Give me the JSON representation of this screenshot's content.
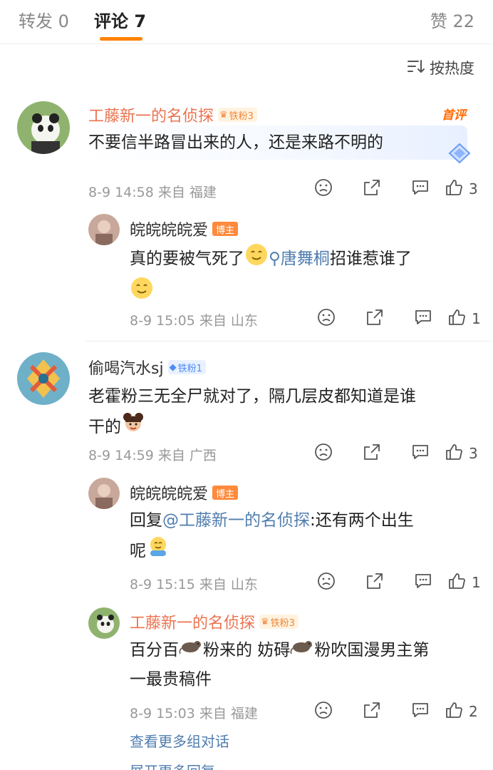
{
  "tabs": [
    {
      "label": "转发 0"
    },
    {
      "label": "评论 7"
    },
    {
      "label": "赞 22"
    }
  ],
  "sort": {
    "label": "按热度"
  },
  "comments": [
    {
      "user": "工藤新一的名侦探",
      "badge": "铁粉3",
      "top_label": "首评",
      "text": "不要信半路冒出来的人，还是来路不明的",
      "time": "8-9 14:58 来自 福建",
      "likes": "3"
    },
    {
      "user": "皖皖皖皖爱",
      "badge": "博主",
      "text_a": "真的要被气死了",
      "topic": "唐舞桐",
      "text_b": "招谁惹谁了",
      "time": "8-9 15:05 来自 山东",
      "likes": "1"
    },
    {
      "user": "偷喝汽水sj",
      "badge": "铁粉1",
      "text_a": "老霍粉三无全尸就对了，隔几层皮都知道是谁",
      "text_b": "干的",
      "time": "8-9 14:59 来自 广西",
      "likes": "3"
    },
    {
      "user": "皖皖皖皖爱",
      "badge": "博主",
      "reply_prefix": "回复",
      "mention": "@工藤新一的名侦探",
      "text_a": ":还有两个出生",
      "text_b": "呢",
      "time": "8-9 15:15 来自 山东",
      "likes": "1"
    },
    {
      "user": "工藤新一的名侦探",
      "badge": "铁粉3",
      "text_a": "百分百",
      "text_b": "粉来的 妨碍",
      "text_c": "粉吹国漫男主第",
      "text_d": "一最贵稿件",
      "time": "8-9 15:03 来自 福建",
      "likes": "2"
    }
  ],
  "more_link": "查看更多组对话",
  "cut_off_text": "展开更多回复",
  "colors": {
    "accent": "#ff8200",
    "username": "#eb7350",
    "link": "#507daf"
  }
}
